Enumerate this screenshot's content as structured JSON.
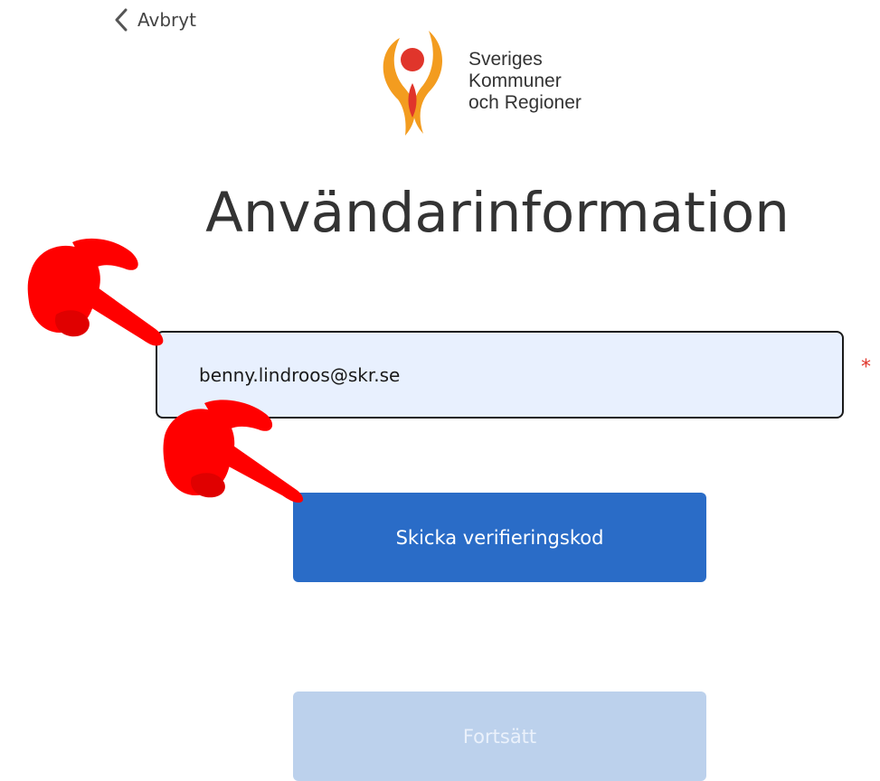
{
  "nav": {
    "back_label": "Avbryt",
    "back_icon": "chevron-left-icon"
  },
  "logo": {
    "line1": "Sveriges",
    "line2": "Kommuner",
    "line3": "och Regioner",
    "colors": {
      "orange": "#f39c1f",
      "red": "#e0352b"
    }
  },
  "page": {
    "title": "Användarinformation"
  },
  "form": {
    "email": {
      "value": "benny.lindroos@skr.se",
      "required_marker": "*"
    },
    "send_code_label": "Skicka verifieringskod",
    "continue_label": "Fortsätt"
  },
  "annotations": {
    "pointer_color": "#ff0000",
    "pointer_icon": "pointing-hand-icon"
  }
}
